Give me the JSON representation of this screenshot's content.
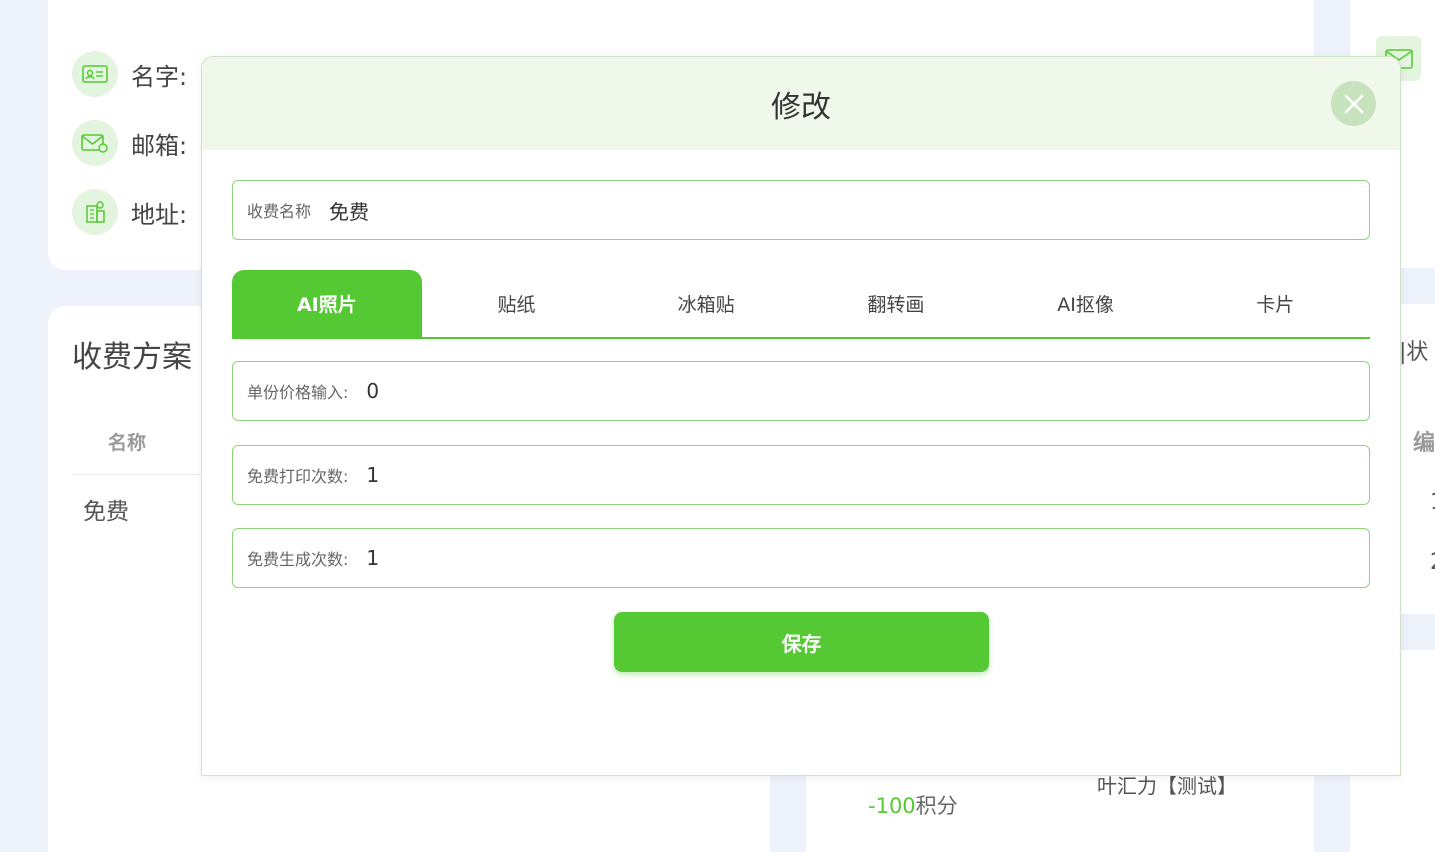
{
  "profile": {
    "name_label": "名字:",
    "email_label": "邮箱:",
    "address_label": "地址:"
  },
  "pricing": {
    "title": "收费方案",
    "column_name": "名称",
    "rows": [
      "免费"
    ]
  },
  "right_panel": {
    "status_fragment": "|状",
    "edit_fragment": "编",
    "row1_fragment": "1",
    "row2_fragment": "2"
  },
  "bottom": {
    "points_value": "-100",
    "points_unit": "积分",
    "user_name": "叶汇力【测试】"
  },
  "modal": {
    "title": "修改",
    "fee_name_label": "收费名称",
    "fee_name_value": "免费",
    "tabs": [
      "AI照片",
      "贴纸",
      "冰箱贴",
      "翻转画",
      "AI抠像",
      "卡片"
    ],
    "active_tab": "AI照片",
    "price_label": "单份价格输入:",
    "price_value": "0",
    "free_print_label": "免费打印次数:",
    "free_print_value": "1",
    "free_gen_label": "免费生成次数:",
    "free_gen_value": "1",
    "save_label": "保存"
  },
  "colors": {
    "accent": "#55c934",
    "header_bg": "#f0f8ec",
    "icon_bg": "#e3f4df",
    "page_bg": "#eef2fb"
  }
}
